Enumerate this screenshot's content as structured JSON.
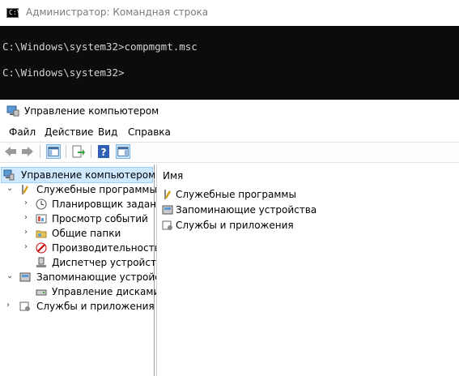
{
  "cmd": {
    "title": "Администратор: Командная строка",
    "lines": [
      "C:\\Windows\\system32>compmgmt.msc",
      "C:\\Windows\\system32>"
    ]
  },
  "mmc": {
    "title": "Управление компьютером",
    "menu": [
      "Файл",
      "Действие",
      "Вид",
      "Справка"
    ],
    "tree": {
      "root": "Управление компьютером (л",
      "system_tools": "Служебные программы",
      "task_scheduler": "Планировщик заданий",
      "event_viewer": "Просмотр событий",
      "shared_folders": "Общие папки",
      "performance": "Производительность",
      "device_manager": "Диспетчер устройств",
      "storage": "Запоминающие устройст",
      "disk_management": "Управление дисками",
      "services_apps": "Службы и приложения"
    },
    "list": {
      "column": "Имя",
      "items": [
        "Служебные программы",
        "Запоминающие устройства",
        "Службы и приложения"
      ]
    }
  },
  "colors": {
    "console_bg": "#0c0c0c",
    "console_text": "#d2d2d2",
    "selection_bg": "#cde8ff"
  }
}
